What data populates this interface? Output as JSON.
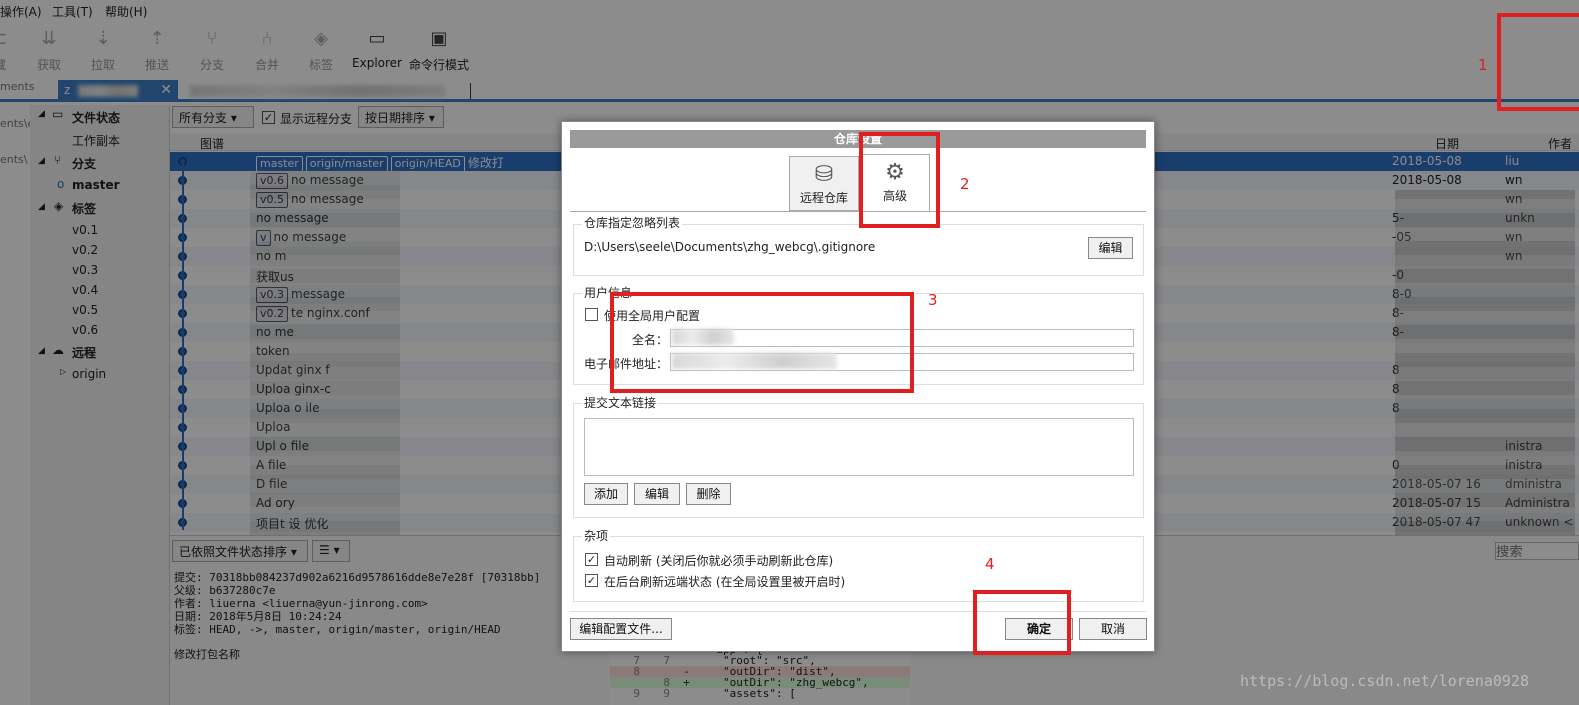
{
  "menu": [
    "操作(A)",
    "工具(T)",
    "帮助(H)"
  ],
  "toolbar": [
    {
      "label": "藏",
      "icon": "stash-icon"
    },
    {
      "label": "获取",
      "icon": "fetch-icon"
    },
    {
      "label": "拉取",
      "icon": "pull-icon"
    },
    {
      "label": "推送",
      "icon": "push-icon"
    },
    {
      "label": "分支",
      "icon": "branch-icon"
    },
    {
      "label": "合并",
      "icon": "merge-icon"
    },
    {
      "label": "标签",
      "icon": "tag-icon"
    },
    {
      "label": "Explorer",
      "icon": "folder-icon"
    },
    {
      "label": "命令行模式",
      "icon": "terminal-icon"
    }
  ],
  "tab": {
    "label": "z",
    "close": "✕"
  },
  "left_gutter": [
    "ments",
    "ents\\e",
    "ents\\"
  ],
  "sidebar": {
    "file_status": "文件状态",
    "working_copy": "工作副本",
    "branches": "分支",
    "master": "master",
    "tags": "标签",
    "tag_items": [
      "v0.1",
      "v0.2",
      "v0.3",
      "v0.4",
      "v0.5",
      "v0.6"
    ],
    "remotes": "远程",
    "origin": "origin"
  },
  "filters": {
    "branches": "所有分支",
    "show_remote": "显示远程分支",
    "sort": "按日期排序"
  },
  "columns": {
    "graph": "图谱",
    "date": "日期",
    "author": "作者"
  },
  "commits": [
    {
      "tags": [
        "master",
        "origin/master",
        "origin/HEAD"
      ],
      "msg": "修改打",
      "date": "2018-05-08",
      "author": "liu"
    },
    {
      "tags": [
        "v0.6"
      ],
      "msg": "no message",
      "date": "2018-05-08",
      "author": "wn"
    },
    {
      "tags": [
        "v0.5"
      ],
      "msg": "no message",
      "date": "",
      "author": "wn"
    },
    {
      "tags": [],
      "msg": "no message",
      "date": "5-",
      "author": "unkn"
    },
    {
      "tags": [
        "v"
      ],
      "msg": "no message",
      "date": "-05",
      "author": "wn"
    },
    {
      "tags": [],
      "msg": "no m",
      "date": "",
      "author": "wn"
    },
    {
      "tags": [],
      "msg": "获取us",
      "date": "-0",
      "author": ""
    },
    {
      "tags": [
        "v0.3"
      ],
      "msg": "message",
      "date": "8-0",
      "author": ""
    },
    {
      "tags": [
        "v0.2"
      ],
      "msg": "te nginx.conf",
      "date": "8-",
      "author": ""
    },
    {
      "tags": [],
      "msg": "no me",
      "date": "8-",
      "author": ""
    },
    {
      "tags": [],
      "msg": "token",
      "date": "",
      "author": ""
    },
    {
      "tags": [],
      "msg": "Updat ginx f",
      "date": "8",
      "author": ""
    },
    {
      "tags": [],
      "msg": "Uploa ginx-c",
      "date": "8",
      "author": ""
    },
    {
      "tags": [],
      "msg": "Uploa o ile",
      "date": "8",
      "author": ""
    },
    {
      "tags": [],
      "msg": "Uploa",
      "date": "",
      "author": ""
    },
    {
      "tags": [],
      "msg": "Upl o file",
      "date": "",
      "author": "inistra"
    },
    {
      "tags": [],
      "msg": "A file",
      "date": "0",
      "author": "inistra"
    },
    {
      "tags": [],
      "msg": "D file",
      "date": "2018-05-07 16",
      "author": "dministra"
    },
    {
      "tags": [],
      "msg": "Ad ory",
      "date": "2018-05-07 15",
      "author": "Administra"
    },
    {
      "tags": [],
      "msg": "项目t 设 优化",
      "date": "2018-05-07 47",
      "author": "unknown <"
    }
  ],
  "bottom": {
    "sort_label": "已依照文件状态排序",
    "search_placeholder": "搜索",
    "details": [
      "提交: 70318bb084237d902a6216d9578616dde8e7e28f [70318bb]",
      "父级: b637280c7e",
      "作者: liuerna <liuerna@yun-jinrong.com>",
      "日期: 2018年5月8日 10:24:24",
      "标签: HEAD, ->, master, origin/master, origin/HEAD"
    ],
    "commit_msg": "修改打包名称"
  },
  "diff": [
    {
      "a": "",
      "b": "",
      "t": "      \"app\": {"
    },
    {
      "a": "7",
      "b": "7",
      "t": "        \"root\": \"src\","
    },
    {
      "a": "8",
      "b": "",
      "t": "  -     \"outDir\": \"dist\","
    },
    {
      "a": "",
      "b": "8",
      "t": "  +     \"outDir\": \"zhg_webcg\","
    },
    {
      "a": "9",
      "b": "9",
      "t": "        \"assets\": ["
    }
  ],
  "dialog": {
    "title": "仓库设置",
    "tab_remote": "远程仓库",
    "tab_advanced": "高级",
    "ignore_group": "仓库指定忽略列表",
    "ignore_path": "D:\\Users\\seele\\Documents\\zhg_webcg\\.gitignore",
    "edit": "编辑",
    "user_group": "用户信息",
    "use_global": "使用全局用户配置",
    "fullname_label": "全名：",
    "email_label": "电子邮件地址：",
    "links_group": "提交文本链接",
    "add": "添加",
    "delete": "删除",
    "misc_group": "杂项",
    "auto_refresh": "自动刷新 (关闭后你就必须手动刷新此仓库)",
    "bg_refresh": "在后台刷新远端状态 (在全局设置里被开启时)",
    "edit_config": "编辑配置文件...",
    "ok": "确定",
    "cancel": "取消"
  },
  "annotations": [
    "1",
    "2",
    "3",
    "4"
  ],
  "watermark": "https://blog.csdn.net/lorena0928",
  "colors": {
    "selection": "#2f6fc7",
    "annotation": "#e02020",
    "tab": "#3d7fc7"
  }
}
